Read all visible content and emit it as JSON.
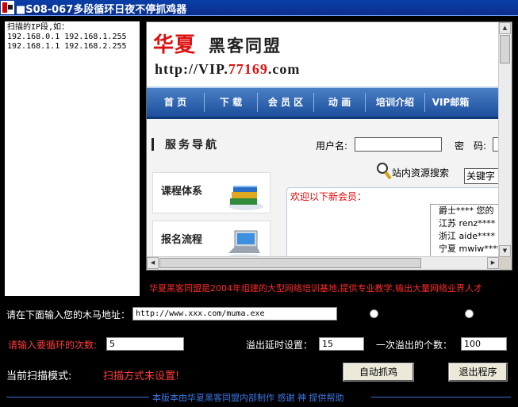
{
  "window": {
    "title": "■S08-067多段循环日夜不停抓鸡器"
  },
  "ip_box": {
    "text": "扫描的IP段,如：\n192.168.0.1 192.168.1.255\n192.168.1.1 192.168.2.255"
  },
  "site": {
    "logo_main": "华夏",
    "logo_sub": "黑客同盟",
    "url_prefix": "http://VIP.",
    "url_number": "77169",
    "url_suffix": ".com",
    "nav": [
      "首 页",
      "下 载",
      "会 员 区",
      "动 画",
      "培训介绍",
      "VIP邮箱"
    ],
    "service_title": "服务导航",
    "cards": [
      "课程体系",
      "报名流程"
    ],
    "username_label": "用户名:",
    "password_label": "密　码:",
    "search_text": "站内资源搜索",
    "keyword_select": "关键字",
    "members_head": "欢迎以下新会员：",
    "members": [
      "爵士**** 您的",
      "江苏 renz****",
      "浙江 aide****",
      "宁夏 mwiw****"
    ]
  },
  "tagline": "华夏黑客同盟是2004年组建的大型网络培训基地,提供专业教学,输出大量网络业界人才",
  "form": {
    "trojan_label": "请在下面输入您的木马地址：",
    "trojan_value": "http://www.xxx.com/muma.exe",
    "loop_label": "请输入要循环的次数:",
    "loop_value": "5",
    "delay_label": "溢出延时设置：",
    "delay_value": "15",
    "per_label": "一次溢出的个数：",
    "per_value": "100",
    "mode_label": "当前扫描模式:",
    "mode_status": "扫描方式未设置!",
    "auto_button": "自动抓鸡",
    "exit_button": "退出程序"
  },
  "footer": "本版本由华夏黑客同盟内部制作 感谢 神 提供帮助",
  "colors": {
    "titlebar": "#0b2f8c",
    "nav_blue": "#1d4f9c",
    "brand_red": "#dd1111",
    "warning_red": "#ff3b3b",
    "footer_blue": "#3b78e6"
  }
}
